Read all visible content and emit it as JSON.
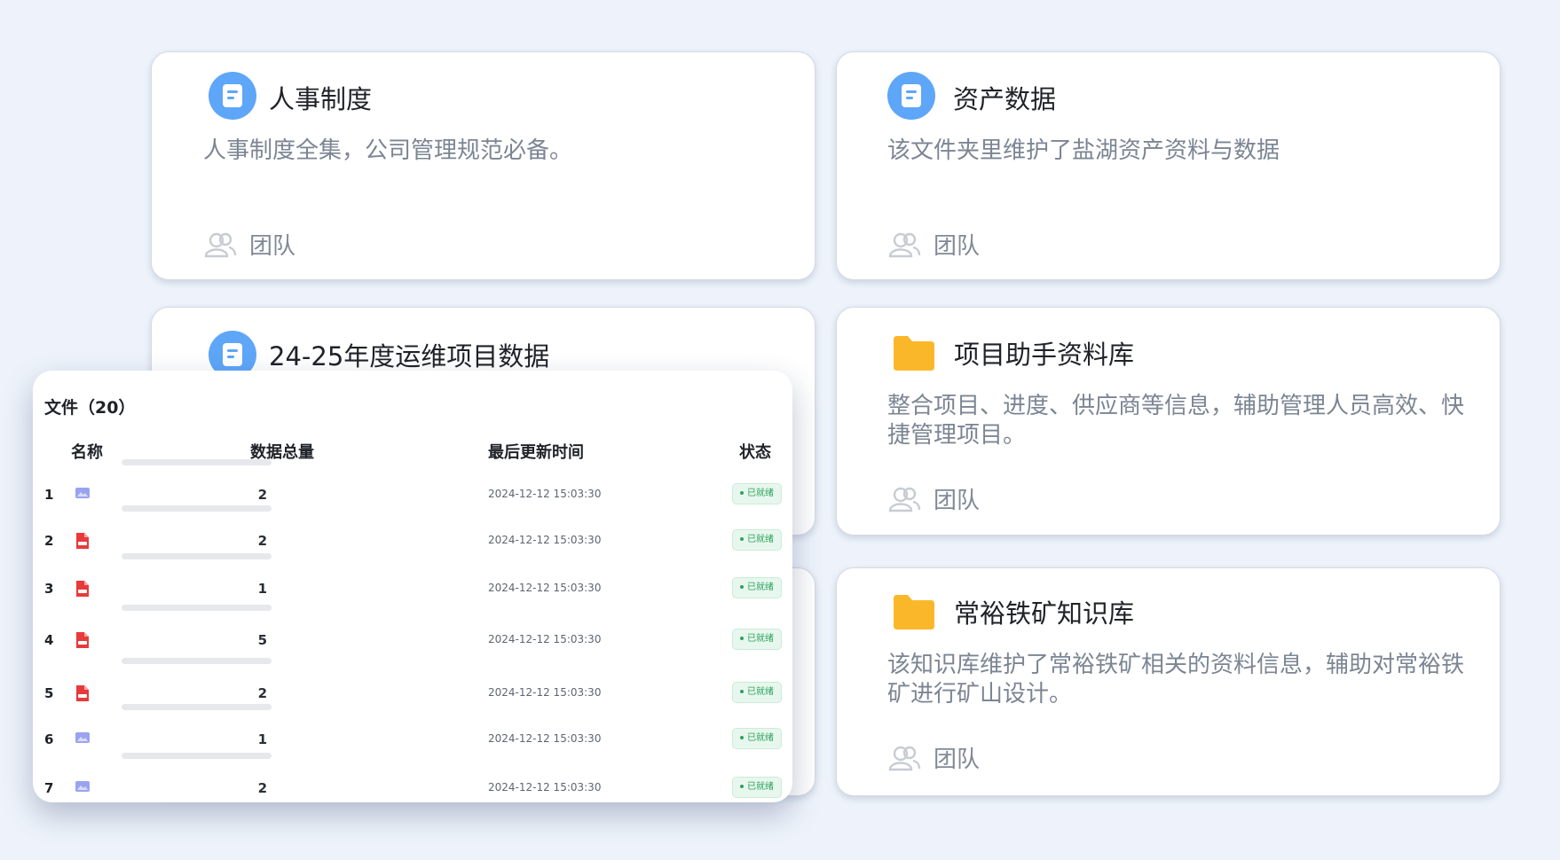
{
  "cards": [
    {
      "title": "人事制度",
      "desc": "人事制度全集，公司管理规范必备。",
      "footer": "团队",
      "icon": "document-icon"
    },
    {
      "title": "资产数据",
      "desc": "该文件夹里维护了盐湖资产资料与数据",
      "footer": "团队",
      "icon": "document-icon"
    },
    {
      "title": "24-25年度运维项目数据",
      "desc": "",
      "footer": "",
      "icon": "document-icon"
    },
    {
      "title": "项目助手资料库",
      "desc": "整合项目、进度、供应商等信息，辅助管理人员高效、快捷管理项目。",
      "footer": "团队",
      "icon": "folder-icon"
    },
    {
      "title": "常裕铁矿知识库",
      "desc": "该知识库维护了常裕铁矿相关的资料信息，辅助对常裕铁矿进行矿山设计。",
      "footer": "团队",
      "icon": "folder-icon"
    }
  ],
  "files_panel": {
    "title": "文件（20）",
    "columns": {
      "name": "名称",
      "count": "数据总量",
      "updated": "最后更新时间",
      "status": "状态"
    },
    "rows": [
      {
        "index": "1",
        "type": "image-file-icon",
        "count": "2",
        "updated": "2024-12-12 15:03:30",
        "status": "已就绪"
      },
      {
        "index": "2",
        "type": "pdf-file-icon",
        "count": "2",
        "updated": "2024-12-12 15:03:30",
        "status": "已就绪"
      },
      {
        "index": "3",
        "type": "pdf-file-icon",
        "count": "1",
        "updated": "2024-12-12 15:03:30",
        "status": "已就绪"
      },
      {
        "index": "4",
        "type": "pdf-file-icon",
        "count": "5",
        "updated": "2024-12-12 15:03:30",
        "status": "已就绪"
      },
      {
        "index": "5",
        "type": "pdf-file-icon",
        "count": "2",
        "updated": "2024-12-12 15:03:30",
        "status": "已就绪"
      },
      {
        "index": "6",
        "type": "image-file-icon",
        "count": "1",
        "updated": "2024-12-12 15:03:30",
        "status": "已就绪"
      },
      {
        "index": "7",
        "type": "image-file-icon",
        "count": "2",
        "updated": "2024-12-12 15:03:30",
        "status": "已就绪"
      }
    ]
  },
  "colors": {
    "accent_blue": "#5ea6f8",
    "folder_yellow": "#fbb72a",
    "status_green": "#2aa35b",
    "pdf_red": "#e83a3a",
    "image_purple": "#9aa3f0"
  }
}
